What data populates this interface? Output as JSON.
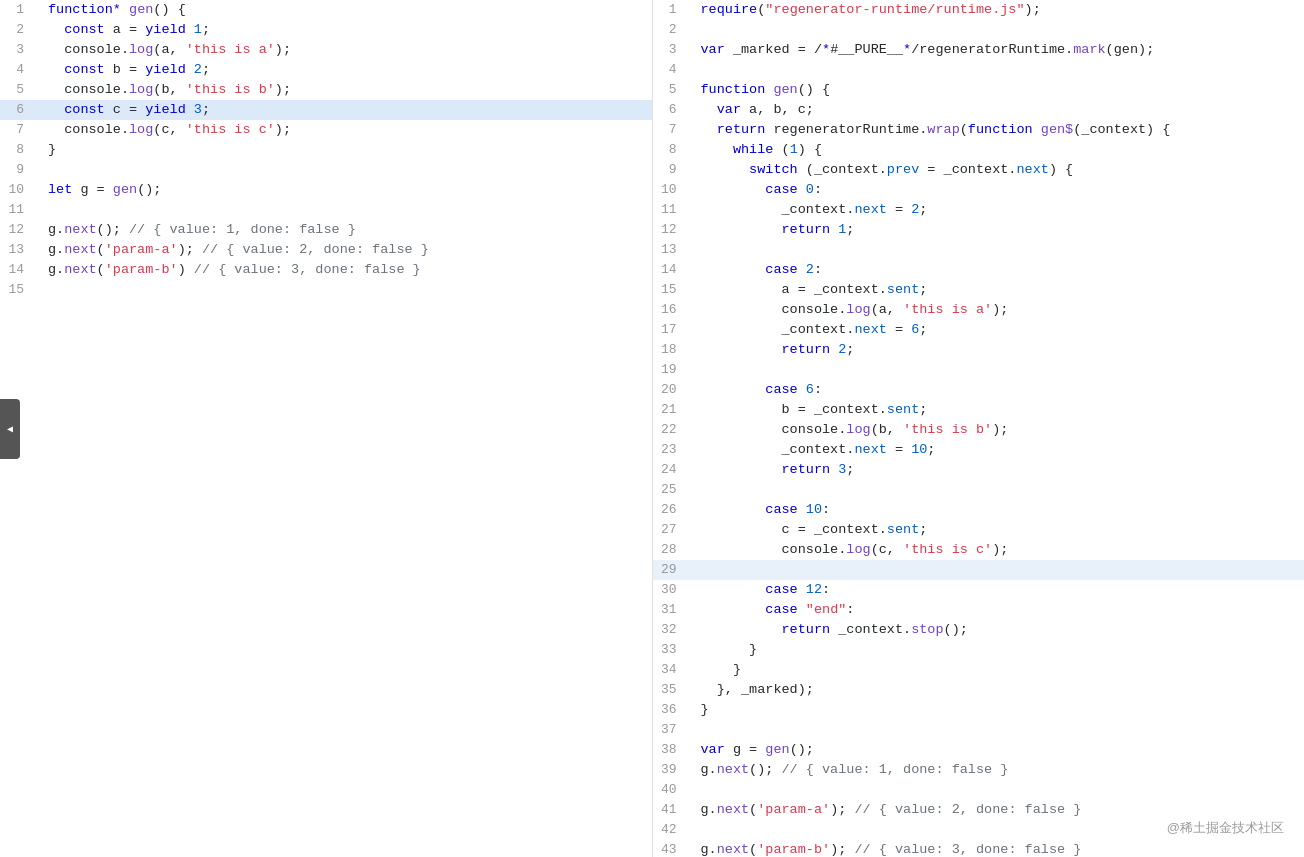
{
  "left_pane": {
    "lines": [
      {
        "num": 1,
        "code": "function* gen() {",
        "highlight": false
      },
      {
        "num": 2,
        "code": "  const a = yield 1;",
        "highlight": false
      },
      {
        "num": 3,
        "code": "  console.log(a, 'this is a');",
        "highlight": false
      },
      {
        "num": 4,
        "code": "  const b = yield 2;",
        "highlight": false
      },
      {
        "num": 5,
        "code": "  console.log(b, 'this is b');",
        "highlight": false
      },
      {
        "num": 6,
        "code": "  const c = yield 3;",
        "highlight": true
      },
      {
        "num": 7,
        "code": "  console.log(c, 'this is c');",
        "highlight": false
      },
      {
        "num": 8,
        "code": "}",
        "highlight": false
      },
      {
        "num": 9,
        "code": "",
        "highlight": false
      },
      {
        "num": 10,
        "code": "let g = gen();",
        "highlight": false
      },
      {
        "num": 11,
        "code": "",
        "highlight": false
      },
      {
        "num": 12,
        "code": "g.next(); // { value: 1, done: false }",
        "highlight": false
      },
      {
        "num": 13,
        "code": "g.next('param-a'); // { value: 2, done: false }",
        "highlight": false
      },
      {
        "num": 14,
        "code": "g.next('param-b') // { value: 3, done: false }",
        "highlight": false
      },
      {
        "num": 15,
        "code": "",
        "highlight": false
      }
    ]
  },
  "right_pane": {
    "lines": [
      {
        "num": 1,
        "code": "require(\"regenerator-runtime/runtime.js\");",
        "highlight": false
      },
      {
        "num": 2,
        "code": "",
        "highlight": false
      },
      {
        "num": 3,
        "code": "var _marked = /*#__PURE__*/regeneratorRuntime.mark(gen);",
        "highlight": false
      },
      {
        "num": 4,
        "code": "",
        "highlight": false
      },
      {
        "num": 5,
        "code": "function gen() {",
        "highlight": false
      },
      {
        "num": 6,
        "code": "  var a, b, c;",
        "highlight": false
      },
      {
        "num": 7,
        "code": "  return regeneratorRuntime.wrap(function gen$(_context) {",
        "highlight": false
      },
      {
        "num": 8,
        "code": "    while (1) {",
        "highlight": false
      },
      {
        "num": 9,
        "code": "      switch (_context.prev = _context.next) {",
        "highlight": false
      },
      {
        "num": 10,
        "code": "        case 0:",
        "highlight": false
      },
      {
        "num": 11,
        "code": "          _context.next = 2;",
        "highlight": false
      },
      {
        "num": 12,
        "code": "          return 1;",
        "highlight": false
      },
      {
        "num": 13,
        "code": "",
        "highlight": false
      },
      {
        "num": 14,
        "code": "        case 2:",
        "highlight": false
      },
      {
        "num": 15,
        "code": "          a = _context.sent;",
        "highlight": false
      },
      {
        "num": 16,
        "code": "          console.log(a, 'this is a');",
        "highlight": false
      },
      {
        "num": 17,
        "code": "          _context.next = 6;",
        "highlight": false
      },
      {
        "num": 18,
        "code": "          return 2;",
        "highlight": false
      },
      {
        "num": 19,
        "code": "",
        "highlight": false
      },
      {
        "num": 20,
        "code": "        case 6:",
        "highlight": false
      },
      {
        "num": 21,
        "code": "          b = _context.sent;",
        "highlight": false
      },
      {
        "num": 22,
        "code": "          console.log(b, 'this is b');",
        "highlight": false
      },
      {
        "num": 23,
        "code": "          _context.next = 10;",
        "highlight": false
      },
      {
        "num": 24,
        "code": "          return 3;",
        "highlight": false
      },
      {
        "num": 25,
        "code": "",
        "highlight": false
      },
      {
        "num": 26,
        "code": "        case 10:",
        "highlight": false
      },
      {
        "num": 27,
        "code": "          c = _context.sent;",
        "highlight": false
      },
      {
        "num": 28,
        "code": "          console.log(c, 'this is c');",
        "highlight": false
      },
      {
        "num": 29,
        "code": "",
        "highlight": true
      },
      {
        "num": 30,
        "code": "        case 12:",
        "highlight": false
      },
      {
        "num": 31,
        "code": "        case \"end\":",
        "highlight": false
      },
      {
        "num": 32,
        "code": "          return _context.stop();",
        "highlight": false
      },
      {
        "num": 33,
        "code": "      }",
        "highlight": false
      },
      {
        "num": 34,
        "code": "    }",
        "highlight": false
      },
      {
        "num": 35,
        "code": "  }, _marked);",
        "highlight": false
      },
      {
        "num": 36,
        "code": "}",
        "highlight": false
      },
      {
        "num": 37,
        "code": "",
        "highlight": false
      },
      {
        "num": 38,
        "code": "var g = gen();",
        "highlight": false
      },
      {
        "num": 39,
        "code": "g.next(); // { value: 1, done: false }",
        "highlight": false
      },
      {
        "num": 40,
        "code": "",
        "highlight": false
      },
      {
        "num": 41,
        "code": "g.next('param-a'); // { value: 2, done: false }",
        "highlight": false
      },
      {
        "num": 42,
        "code": "",
        "highlight": false
      },
      {
        "num": 43,
        "code": "g.next('param-b'); // { value: 3, done: false }",
        "highlight": false
      }
    ]
  },
  "watermark": "@稀土掘金技术社区"
}
